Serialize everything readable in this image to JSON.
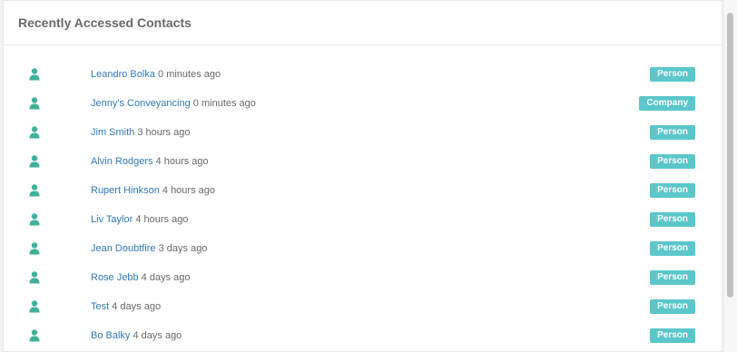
{
  "panel": {
    "title": "Recently Accessed Contacts"
  },
  "colors": {
    "icon": "#3fb19a",
    "link": "#337ab7",
    "badge": "#5bc7cb"
  },
  "contacts": [
    {
      "name": "Leandro Bolka",
      "time": "0 minutes ago",
      "type": "Person",
      "icon": "person-icon"
    },
    {
      "name": "Jenny's Conveyancing",
      "time": "0 minutes ago",
      "type": "Company",
      "icon": "person-icon"
    },
    {
      "name": "Jim Smith",
      "time": "3 hours ago",
      "type": "Person",
      "icon": "person-icon"
    },
    {
      "name": "Alvin Rodgers",
      "time": "4 hours ago",
      "type": "Person",
      "icon": "person-icon"
    },
    {
      "name": "Rupert Hinkson",
      "time": "4 hours ago",
      "type": "Person",
      "icon": "person-icon"
    },
    {
      "name": "Liv Taylor",
      "time": "4 hours ago",
      "type": "Person",
      "icon": "person-icon"
    },
    {
      "name": "Jean Doubtfire",
      "time": "3 days ago",
      "type": "Person",
      "icon": "person-icon"
    },
    {
      "name": "Rose Jebb",
      "time": "4 days ago",
      "type": "Person",
      "icon": "person-icon"
    },
    {
      "name": "Test",
      "time": "4 days ago",
      "type": "Person",
      "icon": "person-icon"
    },
    {
      "name": "Bo Balky",
      "time": "4 days ago",
      "type": "Person",
      "icon": "person-icon"
    }
  ]
}
